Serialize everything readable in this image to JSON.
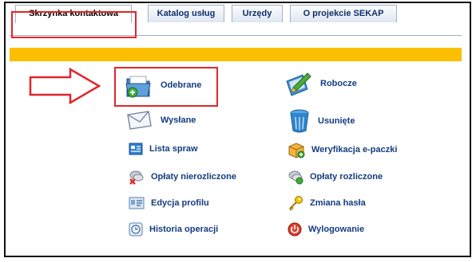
{
  "tabs": [
    {
      "label": "Skrzynka kontaktowa",
      "active": true
    },
    {
      "label": "Katalog usług",
      "active": false
    },
    {
      "label": "Urzędy",
      "active": false
    },
    {
      "label": "O projekcie SEKAP",
      "active": false
    }
  ],
  "menu": {
    "left": [
      {
        "label": "Odebrane",
        "icon": "inbox-icon"
      },
      {
        "label": "Wysłane",
        "icon": "envelope-icon"
      },
      {
        "label": "Lista spraw",
        "icon": "list-icon"
      },
      {
        "label": "Opłaty nierozliczone",
        "icon": "unsettled-payments-icon"
      },
      {
        "label": "Edycja profilu",
        "icon": "profile-icon"
      },
      {
        "label": "Historia operacji",
        "icon": "history-icon"
      }
    ],
    "right": [
      {
        "label": "Robocze",
        "icon": "drafts-icon"
      },
      {
        "label": "Usunięte",
        "icon": "trash-icon"
      },
      {
        "label": "Weryfikacja e-paczki",
        "icon": "package-verify-icon"
      },
      {
        "label": "Opłaty rozliczone",
        "icon": "settled-payments-icon"
      },
      {
        "label": "Zmiana hasła",
        "icon": "key-icon"
      },
      {
        "label": "Wylogowanie",
        "icon": "logout-icon"
      }
    ]
  },
  "colors": {
    "accent_bar": "#fbbf00",
    "highlight": "#e0262b",
    "link": "#143c80"
  }
}
